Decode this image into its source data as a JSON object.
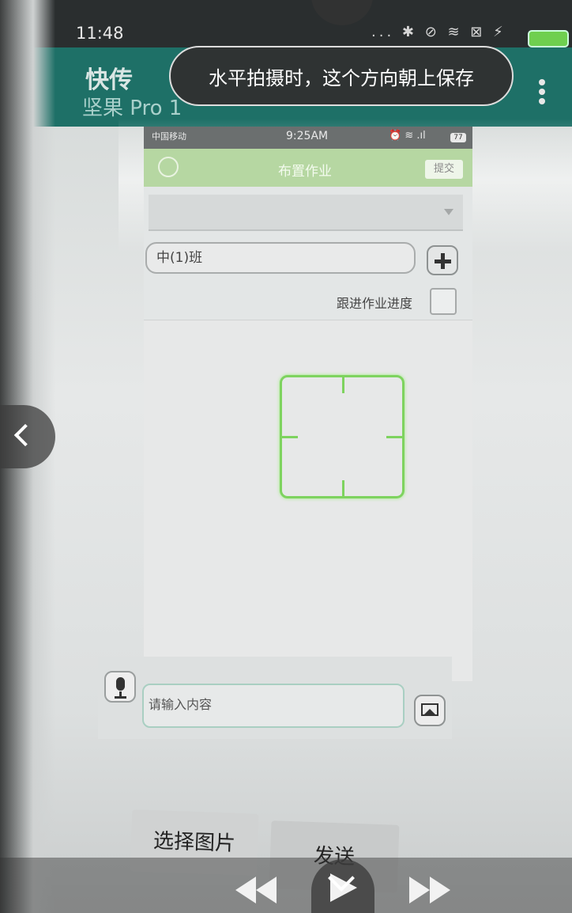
{
  "status_bar": {
    "time": "11:48",
    "icons": "... ✱ ⊘ ≋ ⊠ ⚡"
  },
  "app_header": {
    "title": "快传",
    "subtitle": "坚果 Pro 1"
  },
  "toast": {
    "text": "水平拍摄时，这个方向朝上保存"
  },
  "inner_screen": {
    "carrier": "中国移动",
    "time": "9:25AM",
    "battery": "77",
    "nav_title": "布置作业",
    "submit_label": "提交",
    "class_value": "中(1)班",
    "follow_progress_label": "跟进作业进度",
    "input_placeholder": "请输入内容"
  },
  "actions": {
    "select_image_label": "选择图片",
    "send_label": "发送"
  },
  "colors": {
    "header_teal": "#1e7067",
    "toast_bg": "#2f3333",
    "focus_green": "#7ed35f",
    "inner_nav_green": "#b6d7a2"
  }
}
